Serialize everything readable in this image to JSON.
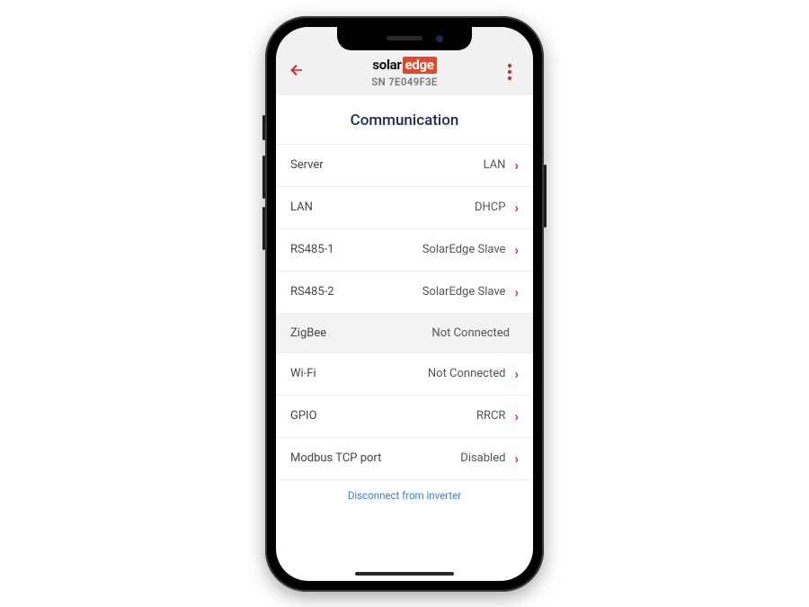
{
  "header": {
    "logo_part1": "solar",
    "logo_part2": "edge",
    "serial": "SN 7E049F3E"
  },
  "page_title": "Communication",
  "rows": [
    {
      "label": "Server",
      "value": "LAN",
      "interactable": true,
      "name": "row-server"
    },
    {
      "label": "LAN",
      "value": "DHCP",
      "interactable": true,
      "name": "row-lan"
    },
    {
      "label": "RS485-1",
      "value": "SolarEdge Slave",
      "interactable": true,
      "name": "row-rs485-1"
    },
    {
      "label": "RS485-2",
      "value": "SolarEdge Slave",
      "interactable": true,
      "name": "row-rs485-2"
    },
    {
      "label": "ZigBee",
      "value": "Not Connected",
      "interactable": false,
      "name": "row-zigbee"
    },
    {
      "label": "Wi-Fi",
      "value": "Not Connected",
      "interactable": true,
      "name": "row-wifi"
    },
    {
      "label": "GPIO",
      "value": "RRCR",
      "interactable": true,
      "name": "row-gpio"
    },
    {
      "label": "Modbus TCP port",
      "value": "Disabled",
      "interactable": true,
      "name": "row-modbus-tcp-port"
    }
  ],
  "footer_link": "Disconnect from inverter"
}
